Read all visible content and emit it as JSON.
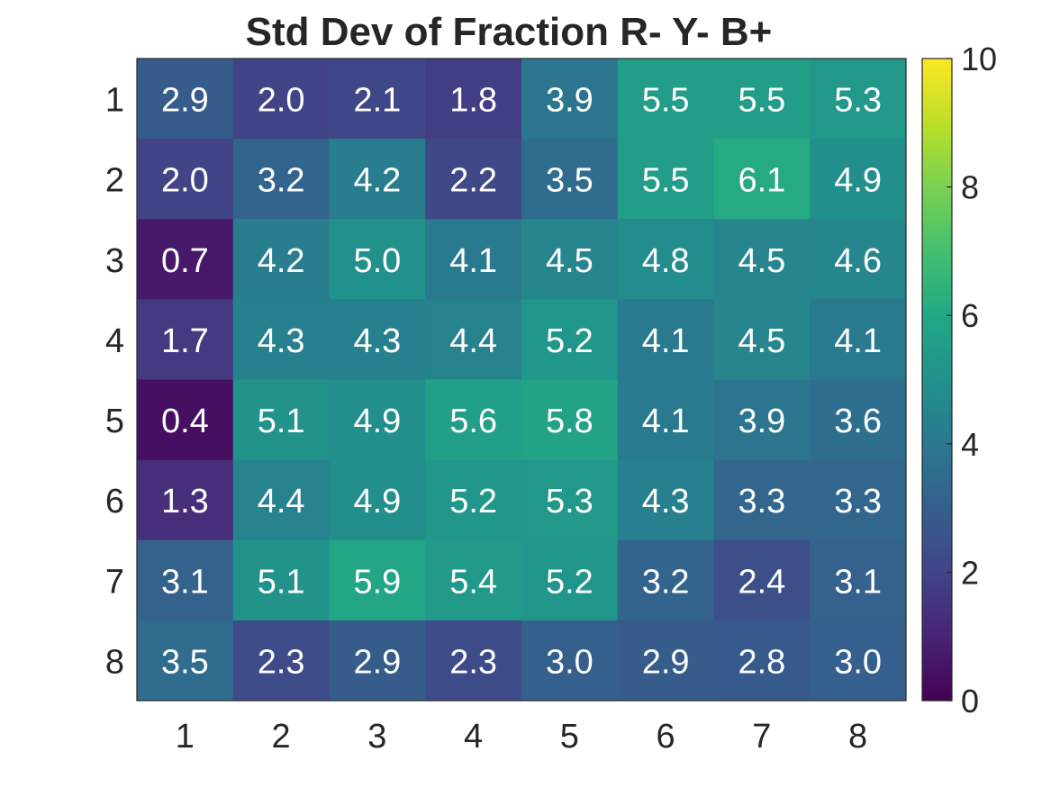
{
  "chart_data": {
    "type": "heatmap",
    "title": "Std Dev of Fraction R- Y- B+",
    "x_categories": [
      "1",
      "2",
      "3",
      "4",
      "5",
      "6",
      "7",
      "8"
    ],
    "y_categories": [
      "1",
      "2",
      "3",
      "4",
      "5",
      "6",
      "7",
      "8"
    ],
    "values": [
      [
        2.9,
        2.0,
        2.1,
        1.8,
        3.9,
        5.5,
        5.5,
        5.3
      ],
      [
        2.0,
        3.2,
        4.2,
        2.2,
        3.5,
        5.5,
        6.1,
        4.9
      ],
      [
        0.7,
        4.2,
        5.0,
        4.1,
        4.5,
        4.8,
        4.5,
        4.6
      ],
      [
        1.7,
        4.3,
        4.3,
        4.4,
        5.2,
        4.1,
        4.5,
        4.1
      ],
      [
        0.4,
        5.1,
        4.9,
        5.6,
        5.8,
        4.1,
        3.9,
        3.6
      ],
      [
        1.3,
        4.4,
        4.9,
        5.2,
        5.3,
        4.3,
        3.3,
        3.3
      ],
      [
        3.1,
        5.1,
        5.9,
        5.4,
        5.2,
        3.2,
        2.4,
        3.1
      ],
      [
        3.5,
        2.3,
        2.9,
        2.3,
        3.0,
        2.9,
        2.8,
        3.0
      ]
    ],
    "value_labels": [
      [
        "2.9",
        "2.0",
        "2.1",
        "1.8",
        "3.9",
        "5.5",
        "5.5",
        "5.3"
      ],
      [
        "2.0",
        "3.2",
        "4.2",
        "2.2",
        "3.5",
        "5.5",
        "6.1",
        "4.9"
      ],
      [
        "0.7",
        "4.2",
        "5.0",
        "4.1",
        "4.5",
        "4.8",
        "4.5",
        "4.6"
      ],
      [
        "1.7",
        "4.3",
        "4.3",
        "4.4",
        "5.2",
        "4.1",
        "4.5",
        "4.1"
      ],
      [
        "0.4",
        "5.1",
        "4.9",
        "5.6",
        "5.8",
        "4.1",
        "3.9",
        "3.6"
      ],
      [
        "1.3",
        "4.4",
        "4.9",
        "5.2",
        "5.3",
        "4.3",
        "3.3",
        "3.3"
      ],
      [
        "3.1",
        "5.1",
        "5.9",
        "5.4",
        "5.2",
        "3.2",
        "2.4",
        "3.1"
      ],
      [
        "3.5",
        "2.3",
        "2.9",
        "2.3",
        "3.0",
        "2.9",
        "2.8",
        "3.0"
      ]
    ],
    "colormap": "viridis",
    "colorbar": {
      "range": [
        0,
        10
      ],
      "ticks": [
        0,
        2,
        4,
        6,
        8,
        10
      ],
      "tick_labels": [
        "0",
        "2",
        "4",
        "6",
        "8",
        "10"
      ],
      "placement": "right"
    },
    "cell_text_color": "#ffffff",
    "xlabel": "",
    "ylabel": ""
  }
}
